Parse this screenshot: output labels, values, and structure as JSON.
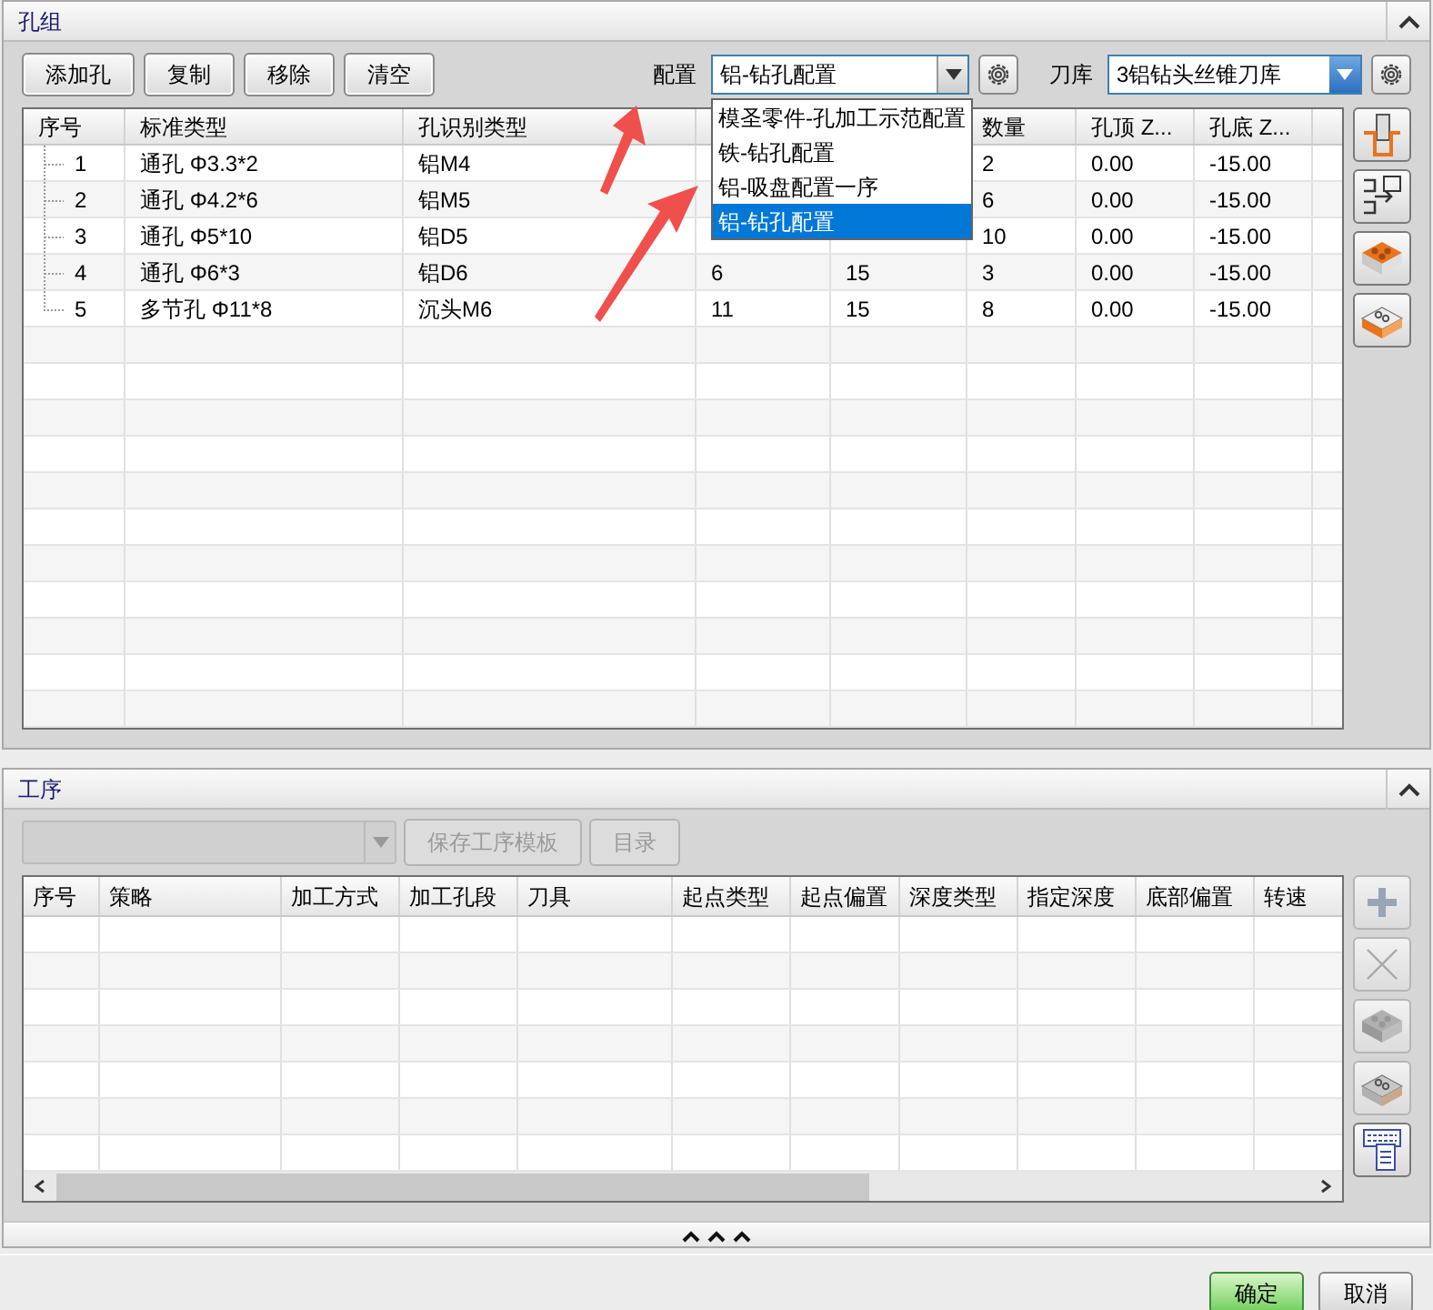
{
  "hole_group": {
    "title": "孔组",
    "buttons": [
      "添加孔",
      "复制",
      "移除",
      "清空"
    ],
    "config": {
      "label": "配置",
      "value": "铝-钻孔配置",
      "expanded": true,
      "options": [
        {
          "label": "模圣零件-孔加工示范配置",
          "selected": false
        },
        {
          "label": "铁-钻孔配置",
          "selected": false
        },
        {
          "label": "铝-吸盘配置一序",
          "selected": false
        },
        {
          "label": "铝-钻孔配置",
          "selected": true
        }
      ]
    },
    "tool_library": {
      "label": "刀库",
      "value": "3铝钻头丝锥刀库",
      "focused": true
    },
    "table": {
      "headers": {
        "index": "序号",
        "standard_type": "标准类型",
        "hole_type": "孔识别类型",
        "quantity": "数量",
        "top_z": "孔顶 Z...",
        "bottom_z": "孔底 Z..."
      },
      "rows": [
        {
          "index": "1",
          "standard_type": "通孔 Φ3.3*2",
          "hole_type": "铝M4",
          "quantity": "2",
          "top_z": "0.00",
          "bottom_z": "-15.00"
        },
        {
          "index": "2",
          "standard_type": "通孔 Φ4.2*6",
          "hole_type": "铝M5",
          "quantity": "6",
          "top_z": "0.00",
          "bottom_z": "-15.00"
        },
        {
          "index": "3",
          "standard_type": "通孔 Φ5*10",
          "hole_type": "铝D5",
          "quantity": "10",
          "top_z": "0.00",
          "bottom_z": "-15.00"
        },
        {
          "index": "4",
          "standard_type": "通孔 Φ6*3",
          "hole_type": "铝D6",
          "column_4": "6",
          "column_5": "15",
          "quantity": "3",
          "top_z": "0.00",
          "bottom_z": "-15.00"
        },
        {
          "index": "5",
          "standard_type": "多节孔 Φ11*8",
          "hole_type": "沉头M6",
          "column_4": "11",
          "column_5": "15",
          "quantity": "8",
          "top_z": "0.00",
          "bottom_z": "-15.00"
        }
      ]
    }
  },
  "process": {
    "title": "工序",
    "strategy": {
      "disabled": true
    },
    "buttons": [
      {
        "label": "保存工序模板",
        "disabled": true
      },
      {
        "label": "目录",
        "disabled": true
      }
    ],
    "columns": [
      "序号",
      "策略",
      "加工方式",
      "加工孔段",
      "刀具",
      "起点类型",
      "起点偏置",
      "深度类型",
      "指定深度",
      "底部偏置",
      "转速"
    ],
    "side_tools": [
      {
        "kind": "add",
        "disabled": true
      },
      {
        "kind": "delete",
        "disabled": true
      },
      {
        "kind": "block",
        "disabled": true
      },
      {
        "kind": "block_holes",
        "disabled": true
      },
      {
        "kind": "table",
        "disabled": false
      }
    ]
  },
  "footer": {
    "buttons": [
      {
        "label": "确定",
        "kind": "primary"
      },
      {
        "label": "取消",
        "kind": "normal"
      }
    ]
  }
}
